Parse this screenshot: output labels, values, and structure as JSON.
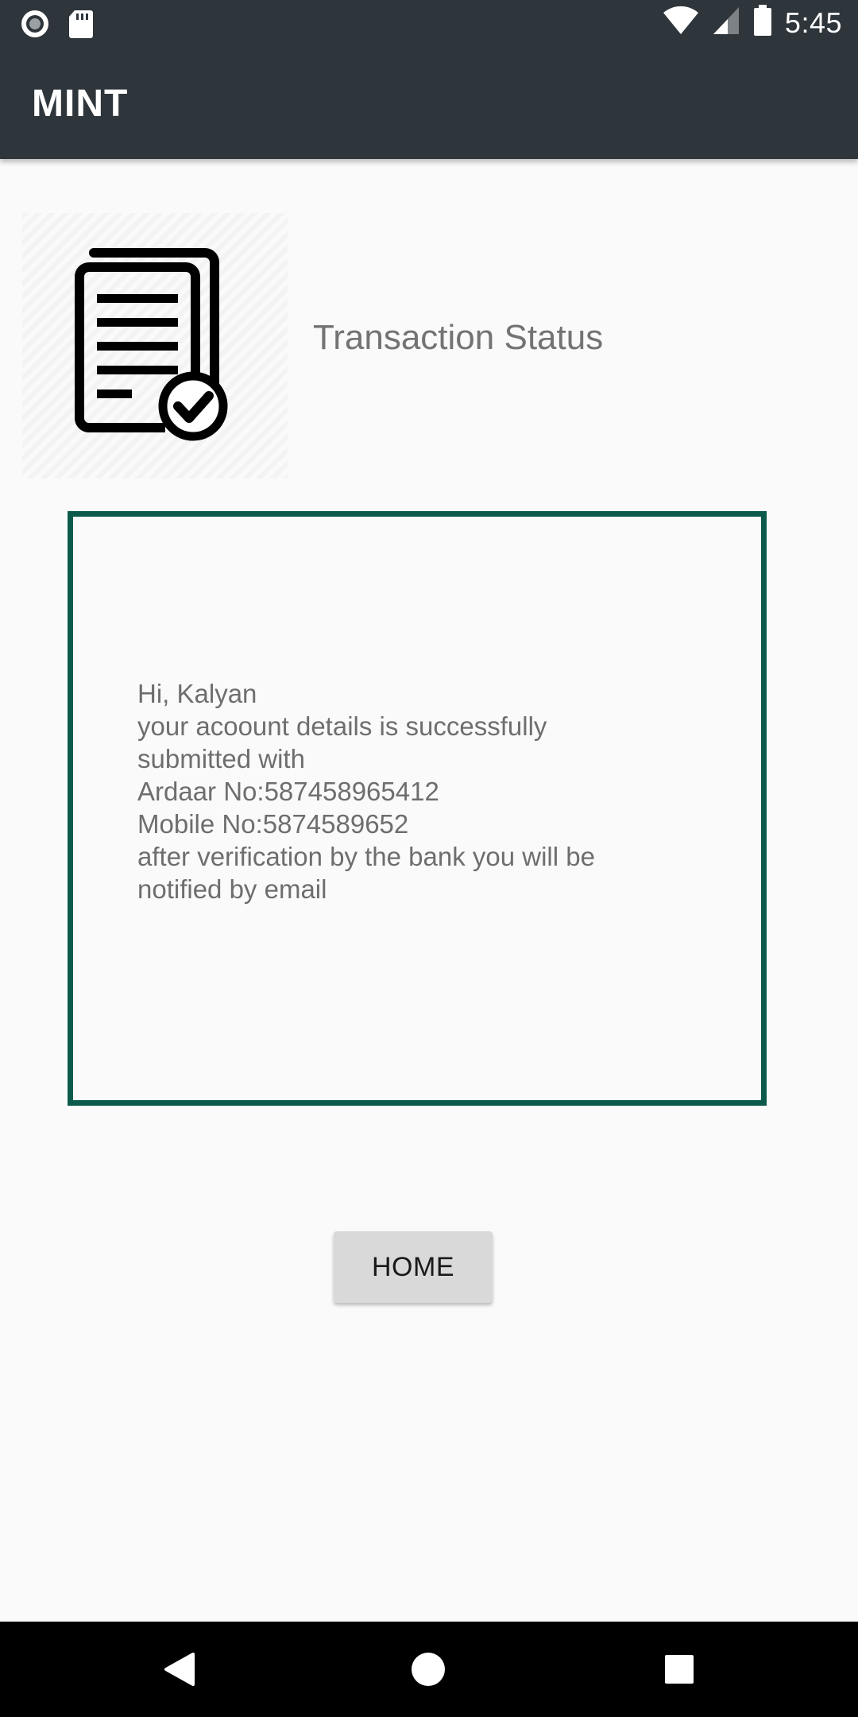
{
  "status_bar": {
    "time": "5:45",
    "icons": [
      "record-icon",
      "sd-card-icon",
      "wifi-icon",
      "cell-signal-icon",
      "battery-icon"
    ]
  },
  "app_bar": {
    "title": "MINT"
  },
  "header": {
    "icon": "document-check-icon",
    "title": "Transaction Status"
  },
  "message": {
    "lines": [
      "Hi, Kalyan",
      "your acoount details is successfully",
      "submitted with",
      "Ardaar No:587458965412",
      "Mobile No:5874589652",
      "after verification by the bank you will be",
      "notified by email"
    ]
  },
  "home_button": {
    "label": "HOME"
  },
  "nav_bar": {
    "icons": [
      "back-icon",
      "home-circle-icon",
      "recents-icon"
    ]
  },
  "colors": {
    "app_bar": "#2e353b",
    "message_border": "#0c5a4c",
    "background": "#fafafa",
    "button": "#d9d9d9"
  }
}
